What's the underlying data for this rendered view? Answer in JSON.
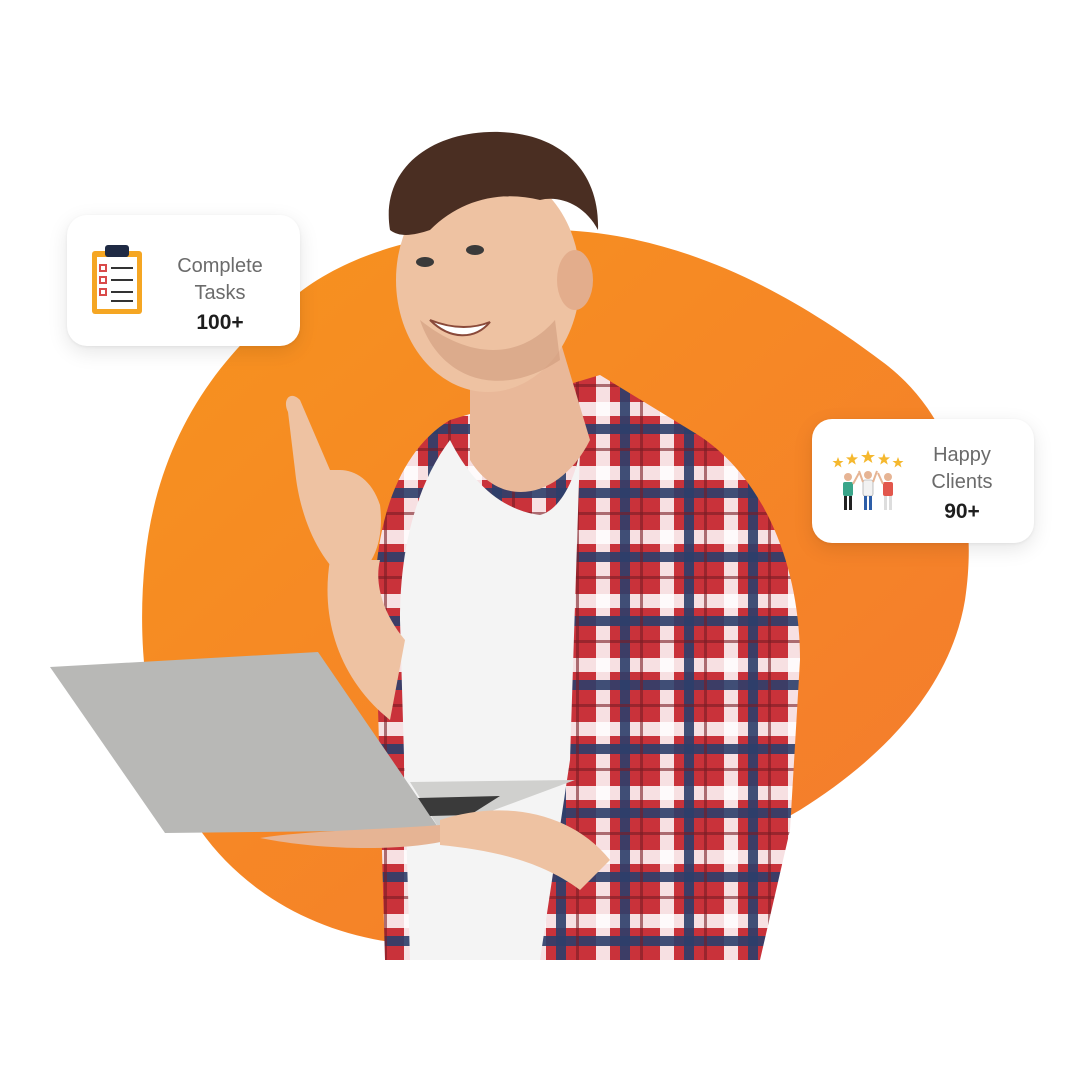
{
  "background": {
    "accent": "#F7931E",
    "accent_dark": "#F47A2E"
  },
  "stats": [
    {
      "line1": "Complete",
      "line2": "Tasks",
      "value": "100+",
      "icon": "clipboard-checklist-icon"
    },
    {
      "line1": "Happy",
      "line2": "Clients",
      "value": "90+",
      "icon": "happy-clients-stars-icon"
    }
  ]
}
